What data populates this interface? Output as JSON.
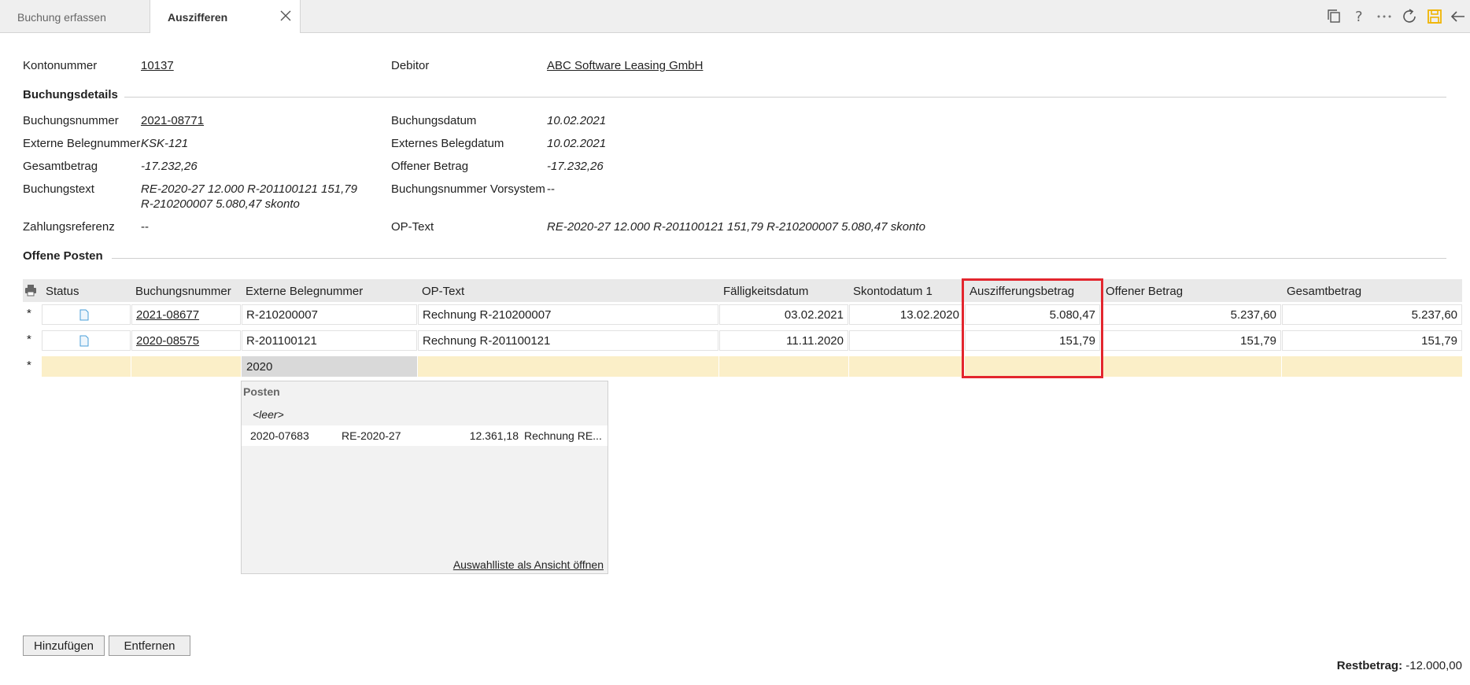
{
  "tabs": [
    {
      "label": "Buchung erfassen"
    },
    {
      "label": "Auszifferen"
    }
  ],
  "account": {
    "kontonummer_label": "Kontonummer",
    "kontonummer": "10137",
    "debitor_label": "Debitor",
    "debitor": "ABC Software Leasing GmbH"
  },
  "details": {
    "section_title": "Buchungsdetails",
    "buchungsnummer_label": "Buchungsnummer",
    "buchungsnummer": "2021-08771",
    "ext_beleg_label": "Externe Belegnummer",
    "ext_beleg": "KSK-121",
    "gesamtbetrag_label": "Gesamtbetrag",
    "gesamtbetrag": "-17.232,26",
    "buchungstext_label": "Buchungstext",
    "buchungstext_line1": "RE-2020-27 12.000 R-201100121 151,79",
    "buchungstext_line2": "R-210200007 5.080,47 skonto",
    "zahlungsreferenz_label": "Zahlungsreferenz",
    "zahlungsreferenz": "--",
    "buchungsdatum_label": "Buchungsdatum",
    "buchungsdatum": "10.02.2021",
    "ext_belegdatum_label": "Externes Belegdatum",
    "ext_belegdatum": "10.02.2021",
    "offener_betrag_label": "Offener Betrag",
    "offener_betrag": "-17.232,26",
    "vorsystem_label": "Buchungsnummer Vorsystem",
    "vorsystem": "--",
    "optext_label": "OP-Text",
    "optext": "RE-2020-27 12.000 R-201100121 151,79 R-210200007 5.080,47 skonto"
  },
  "open_items": {
    "section_title": "Offene Posten",
    "columns": [
      "Status",
      "Buchungsnummer",
      "Externe Belegnummer",
      "OP-Text",
      "Fälligkeitsdatum",
      "Skontodatum 1",
      "Auszifferungsbetrag",
      "Offener Betrag",
      "Gesamtbetrag"
    ],
    "rows": [
      {
        "marker": "*",
        "buchungsnummer": "2021-08677",
        "ext_beleg": "R-210200007",
        "optext": "Rechnung R-210200007",
        "faellig": "03.02.2021",
        "skonto": "13.02.2020",
        "auszifferung": "5.080,47",
        "offen": "5.237,60",
        "gesamt": "5.237,60"
      },
      {
        "marker": "*",
        "buchungsnummer": "2020-08575",
        "ext_beleg": "R-201100121",
        "optext": "Rechnung R-201100121",
        "faellig": "11.11.2020",
        "skonto": "",
        "auszifferung": "151,79",
        "offen": "151,79",
        "gesamt": "151,79"
      }
    ],
    "new_row": {
      "marker": "*",
      "input_value": "2020"
    }
  },
  "dropdown": {
    "title": "Posten",
    "empty_option": "<leer>",
    "options": [
      {
        "nr": "2020-07683",
        "beleg": "RE-2020-27",
        "betrag": "12.361,18",
        "text": "Rechnung RE..."
      }
    ],
    "open_link": "Auswahlliste als Ansicht öffnen"
  },
  "buttons": {
    "add": "Hinzufügen",
    "remove": "Entfernen"
  },
  "footer": {
    "rest_label": "Restbetrag:",
    "rest_value": "-12.000,00"
  },
  "icons": [
    "copy-icon",
    "help-icon",
    "more-icon",
    "refresh-icon",
    "save-icon",
    "back-arrow-icon",
    "close-icon",
    "printer-icon",
    "document-icon"
  ],
  "colors": {
    "highlight": "#e3262e",
    "new_row": "#fbefc8",
    "save_icon": "#f0b400"
  }
}
